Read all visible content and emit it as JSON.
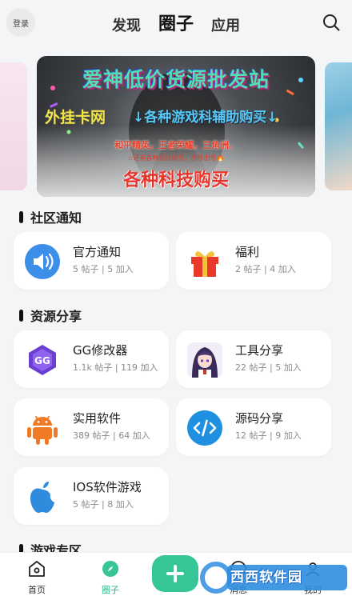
{
  "header": {
    "login_label": "登录",
    "tabs": [
      {
        "label": "发现",
        "active": false
      },
      {
        "label": "圈子",
        "active": true
      },
      {
        "label": "应用",
        "active": false
      }
    ]
  },
  "banner": {
    "line1": "爱神低价货源批发站",
    "line2a": "外挂卡网",
    "line2b": "↓各种游戏科辅助购买↓",
    "line3": "和平精英，王者荣耀，三角洲。",
    "line4": "☆还有各种游戏账号，小号出号🔥",
    "line5": "各种科技购买"
  },
  "sections": [
    {
      "title": "社区通知",
      "cards": [
        {
          "name": "官方通知",
          "meta": "5 帖子 | 5 加入",
          "icon": "speaker-icon"
        },
        {
          "name": "福利",
          "meta": "2 帖子 | 4 加入",
          "icon": "gift-icon"
        }
      ]
    },
    {
      "title": "资源分享",
      "cards": [
        {
          "name": "GG修改器",
          "meta": "1.1k 帖子 | 119 加入",
          "icon": "gg-icon"
        },
        {
          "name": "工具分享",
          "meta": "22 帖子 | 5 加入",
          "icon": "anime-avatar-icon"
        },
        {
          "name": "实用软件",
          "meta": "389 帖子 | 64 加入",
          "icon": "android-icon"
        },
        {
          "name": "源码分享",
          "meta": "12 帖子 | 9 加入",
          "icon": "code-icon"
        },
        {
          "name": "IOS软件游戏",
          "meta": "5 帖子 | 8 加入",
          "icon": "apple-icon"
        }
      ]
    },
    {
      "title": "游戏专区",
      "cards": []
    }
  ],
  "bottom_nav": {
    "items": [
      {
        "label": "首页",
        "icon": "home-icon"
      },
      {
        "label": "圈子",
        "icon": "compass-icon",
        "active": true
      },
      {
        "label": "消息",
        "icon": "message-icon"
      },
      {
        "label": "我的",
        "icon": "user-icon"
      }
    ]
  },
  "watermark": {
    "text": "西西软件园"
  },
  "colors": {
    "accent": "#36c597",
    "background": "#f4f5f7",
    "speaker_blue": "#3b8fe8",
    "code_blue": "#1f8fe0",
    "android_orange": "#f07a26",
    "apple_blue": "#2f8bdc",
    "gift_red": "#e8392a"
  }
}
